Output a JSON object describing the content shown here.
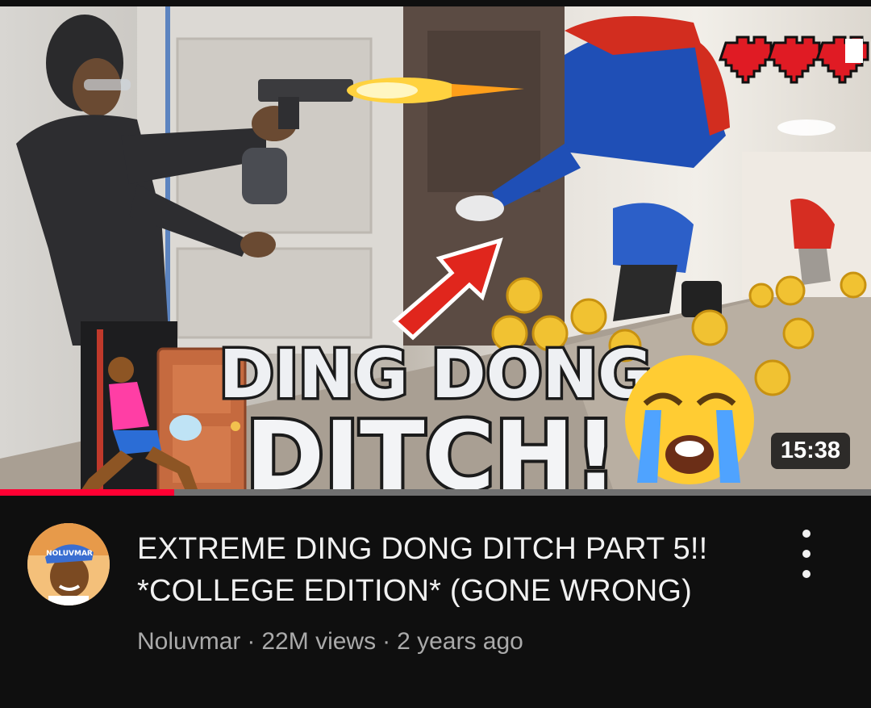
{
  "video": {
    "title": "EXTREME DING DONG DITCH PART 5!! *COLLEGE EDITION* (GONE WRONG)",
    "channel": "Noluvmar",
    "views": "22M views",
    "age": "2 years ago",
    "separator": "·",
    "duration": "15:38",
    "watch_progress": 0.2,
    "accent_color": "#ff0033"
  },
  "thumbnail": {
    "headline_line1": "DING DONG",
    "headline_line2": "DITCH!",
    "hearts": [
      "full",
      "full",
      "half"
    ]
  },
  "avatar": {
    "cap_text": "NOLUVMAR"
  },
  "icons": {
    "more": "more-vert-icon",
    "heart": "heart-icon",
    "coin": "coin-icon",
    "arrow": "arrow-icon",
    "crying_face": "crying-face-icon",
    "door": "door-icon",
    "runner": "running-person-icon"
  }
}
